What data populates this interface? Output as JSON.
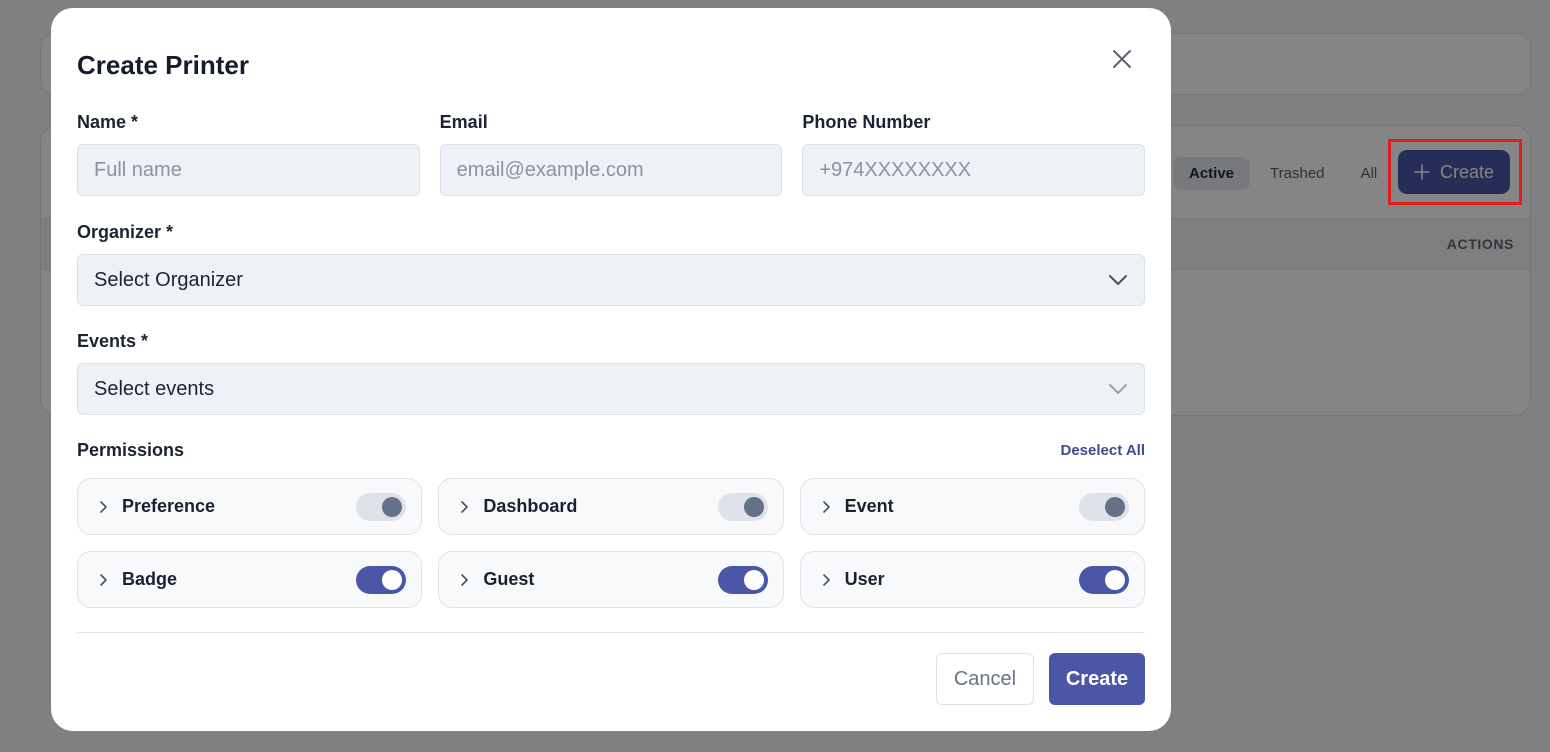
{
  "background": {
    "filters": [
      {
        "label": "Active",
        "active": true
      },
      {
        "label": "Trashed",
        "active": false
      },
      {
        "label": "All",
        "active": false
      }
    ],
    "create_label": "Create",
    "actions_header": "ACTIONS"
  },
  "modal": {
    "title": "Create Printer",
    "fields": {
      "name": {
        "label": "Name *",
        "placeholder": "Full name"
      },
      "email": {
        "label": "Email",
        "placeholder": "email@example.com"
      },
      "phone": {
        "label": "Phone Number",
        "placeholder": "+974XXXXXXXX"
      },
      "organizer": {
        "label": "Organizer *",
        "value": "Select Organizer"
      },
      "events": {
        "label": "Events *",
        "value": "Select events"
      }
    },
    "permissions": {
      "title": "Permissions",
      "deselect_label": "Deselect All",
      "items": [
        {
          "name": "Preference",
          "enabled": false
        },
        {
          "name": "Dashboard",
          "enabled": false
        },
        {
          "name": "Event",
          "enabled": false
        },
        {
          "name": "Badge",
          "enabled": true
        },
        {
          "name": "Guest",
          "enabled": true
        },
        {
          "name": "User",
          "enabled": true
        }
      ]
    },
    "footer": {
      "cancel_label": "Cancel",
      "create_label": "Create"
    }
  },
  "colors": {
    "primary": "#4a56a6",
    "highlight": "#e01f1f"
  }
}
